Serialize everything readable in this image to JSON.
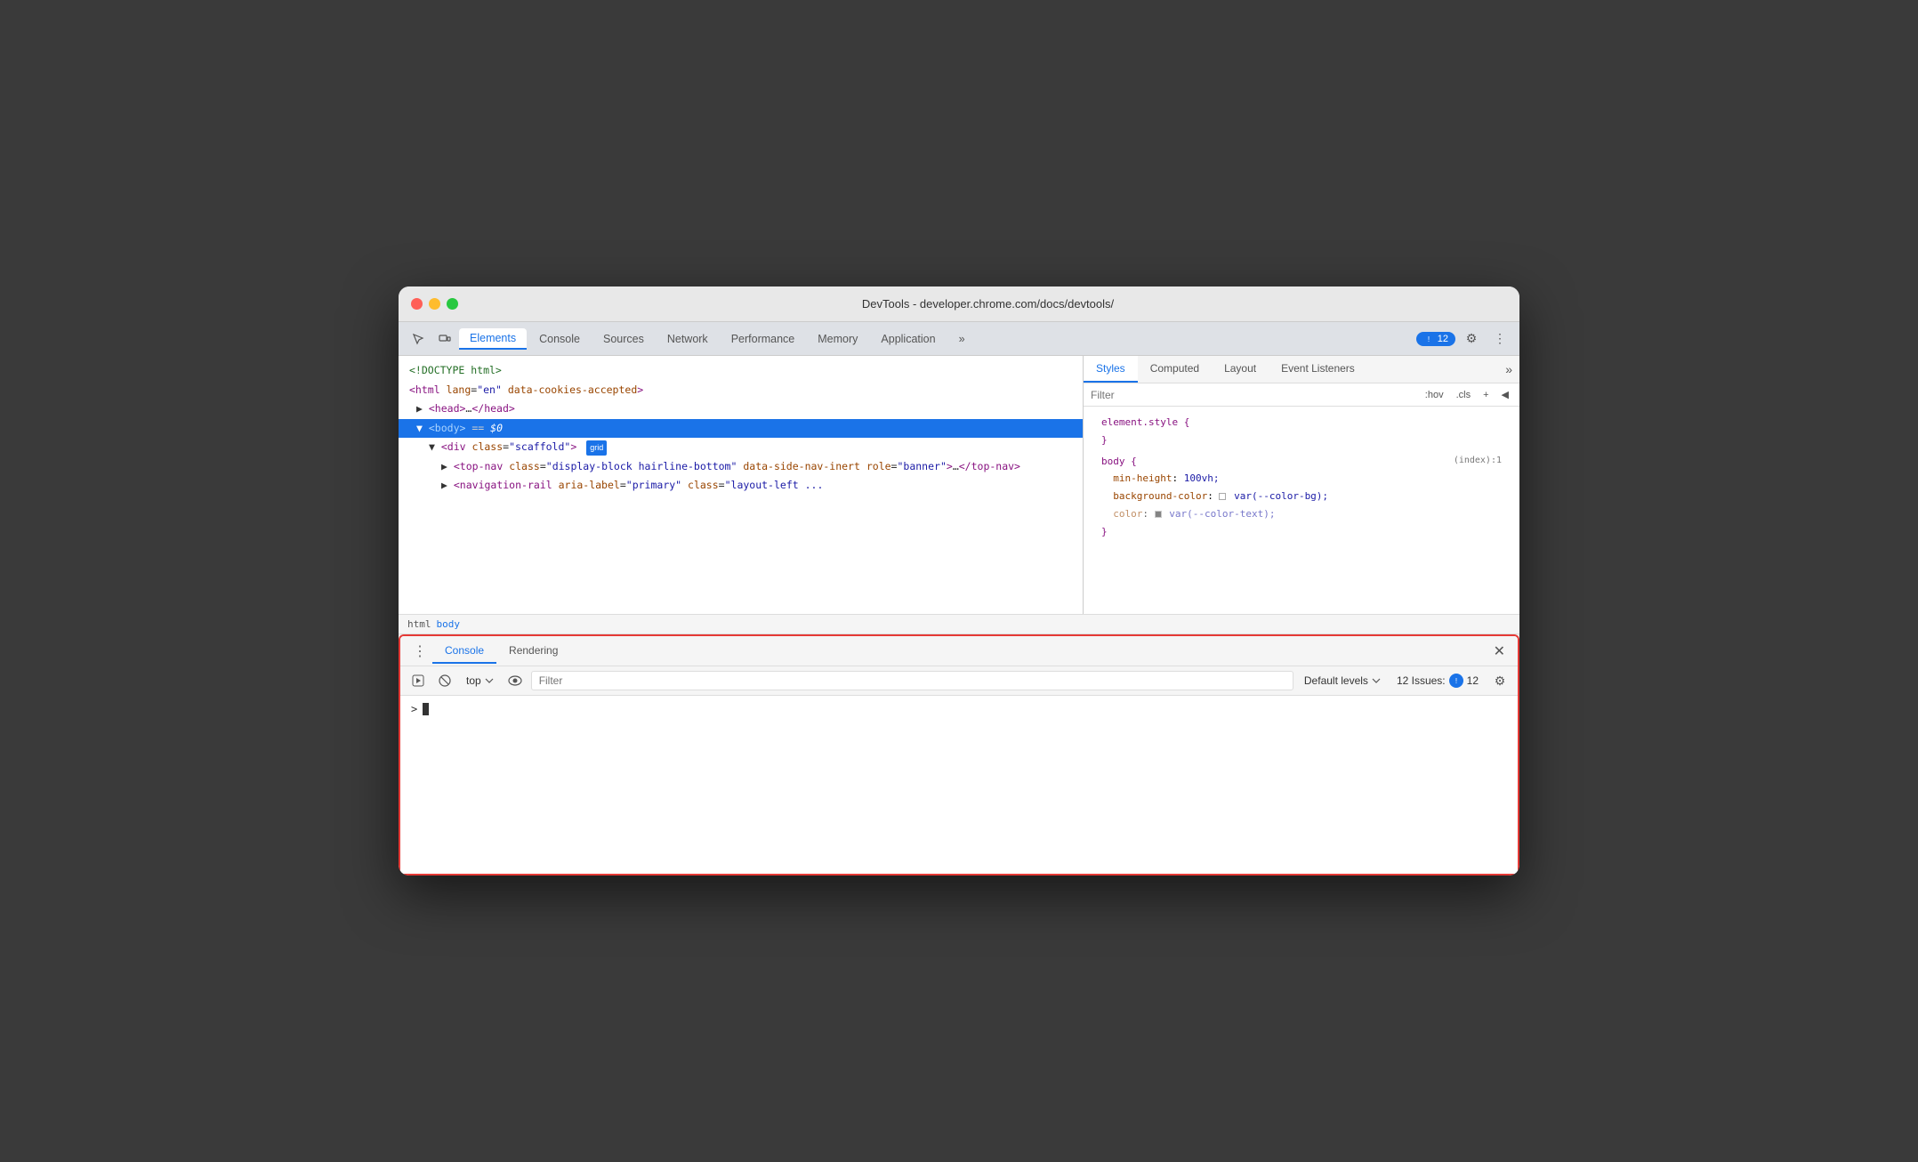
{
  "window": {
    "title": "DevTools - developer.chrome.com/docs/devtools/"
  },
  "titlebar": {
    "traffic_lights": [
      "red",
      "yellow",
      "green"
    ]
  },
  "devtools": {
    "tabs": [
      {
        "label": "Elements",
        "active": true
      },
      {
        "label": "Console",
        "active": false
      },
      {
        "label": "Sources",
        "active": false
      },
      {
        "label": "Network",
        "active": false
      },
      {
        "label": "Performance",
        "active": false
      },
      {
        "label": "Memory",
        "active": false
      },
      {
        "label": "Application",
        "active": false
      }
    ],
    "more_tabs_label": "»",
    "issues_count": "12",
    "issues_label": "12 Issues:",
    "settings_label": "⚙",
    "more_options_label": "⋮"
  },
  "elements_panel": {
    "lines": [
      {
        "text": "<!DOCTYPE html>",
        "class": "comment",
        "indent": 0
      },
      {
        "text": "<html lang=\"en\" data-cookies-accepted>",
        "indent": 0
      },
      {
        "text": "▶ <head>…</head>",
        "indent": 1
      },
      {
        "text": "▼ <body> == $0",
        "indent": 1,
        "selected": true
      },
      {
        "text": "▼ <div class=\"scaffold\">",
        "indent": 2,
        "badge": "grid"
      },
      {
        "text": "▶ <top-nav class=\"display-block hairline-bottom\" data-side-nav-inert role=\"banner\">…</top-nav>",
        "indent": 3
      },
      {
        "text": "▶ <navigation-rail aria-label=\"primary\" class=\"layout-left ...",
        "indent": 3
      }
    ]
  },
  "breadcrumb": {
    "items": [
      "html",
      "body"
    ]
  },
  "styles_panel": {
    "tabs": [
      {
        "label": "Styles",
        "active": true
      },
      {
        "label": "Computed",
        "active": false
      },
      {
        "label": "Layout",
        "active": false
      },
      {
        "label": "Event Listeners",
        "active": false
      }
    ],
    "filter_placeholder": "Filter",
    "hov_label": ":hov",
    "cls_label": ".cls",
    "plus_label": "+",
    "rules": [
      {
        "selector": "element.style {",
        "close": "}",
        "props": []
      },
      {
        "selector": "body {",
        "meta": "(index):1",
        "close": "}",
        "props": [
          {
            "name": "min-height",
            "val": "100vh;"
          },
          {
            "name": "background-color",
            "val": "var(--color-bg);",
            "swatch": true
          },
          {
            "name": "color",
            "val": "var(--color-text);",
            "swatch": true
          }
        ]
      }
    ]
  },
  "console_drawer": {
    "tabs": [
      {
        "label": "Console",
        "active": true
      },
      {
        "label": "Rendering",
        "active": false
      }
    ],
    "toolbar": {
      "execute_label": "▶",
      "block_label": "🚫",
      "context": "top",
      "eye_label": "👁",
      "filter_placeholder": "Filter",
      "levels_label": "Default levels",
      "issues_count": "12",
      "issues_label": "12 Issues:",
      "settings_label": "⚙"
    },
    "prompt_symbol": ">",
    "cursor_char": "|"
  }
}
